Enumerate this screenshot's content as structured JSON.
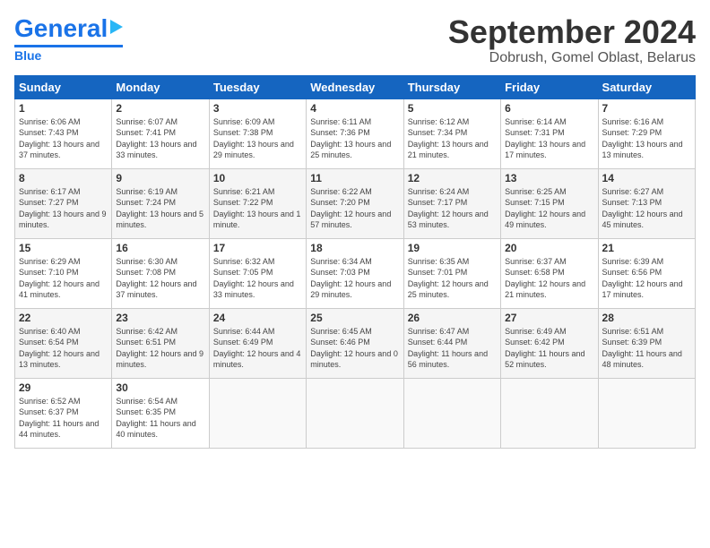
{
  "header": {
    "logo_general": "General",
    "logo_blue": "Blue",
    "month_title": "September 2024",
    "location": "Dobrush, Gomel Oblast, Belarus"
  },
  "weekdays": [
    "Sunday",
    "Monday",
    "Tuesday",
    "Wednesday",
    "Thursday",
    "Friday",
    "Saturday"
  ],
  "weeks": [
    [
      {
        "day": "1",
        "sunrise": "Sunrise: 6:06 AM",
        "sunset": "Sunset: 7:43 PM",
        "daylight": "Daylight: 13 hours and 37 minutes."
      },
      {
        "day": "2",
        "sunrise": "Sunrise: 6:07 AM",
        "sunset": "Sunset: 7:41 PM",
        "daylight": "Daylight: 13 hours and 33 minutes."
      },
      {
        "day": "3",
        "sunrise": "Sunrise: 6:09 AM",
        "sunset": "Sunset: 7:38 PM",
        "daylight": "Daylight: 13 hours and 29 minutes."
      },
      {
        "day": "4",
        "sunrise": "Sunrise: 6:11 AM",
        "sunset": "Sunset: 7:36 PM",
        "daylight": "Daylight: 13 hours and 25 minutes."
      },
      {
        "day": "5",
        "sunrise": "Sunrise: 6:12 AM",
        "sunset": "Sunset: 7:34 PM",
        "daylight": "Daylight: 13 hours and 21 minutes."
      },
      {
        "day": "6",
        "sunrise": "Sunrise: 6:14 AM",
        "sunset": "Sunset: 7:31 PM",
        "daylight": "Daylight: 13 hours and 17 minutes."
      },
      {
        "day": "7",
        "sunrise": "Sunrise: 6:16 AM",
        "sunset": "Sunset: 7:29 PM",
        "daylight": "Daylight: 13 hours and 13 minutes."
      }
    ],
    [
      {
        "day": "8",
        "sunrise": "Sunrise: 6:17 AM",
        "sunset": "Sunset: 7:27 PM",
        "daylight": "Daylight: 13 hours and 9 minutes."
      },
      {
        "day": "9",
        "sunrise": "Sunrise: 6:19 AM",
        "sunset": "Sunset: 7:24 PM",
        "daylight": "Daylight: 13 hours and 5 minutes."
      },
      {
        "day": "10",
        "sunrise": "Sunrise: 6:21 AM",
        "sunset": "Sunset: 7:22 PM",
        "daylight": "Daylight: 13 hours and 1 minute."
      },
      {
        "day": "11",
        "sunrise": "Sunrise: 6:22 AM",
        "sunset": "Sunset: 7:20 PM",
        "daylight": "Daylight: 12 hours and 57 minutes."
      },
      {
        "day": "12",
        "sunrise": "Sunrise: 6:24 AM",
        "sunset": "Sunset: 7:17 PM",
        "daylight": "Daylight: 12 hours and 53 minutes."
      },
      {
        "day": "13",
        "sunrise": "Sunrise: 6:25 AM",
        "sunset": "Sunset: 7:15 PM",
        "daylight": "Daylight: 12 hours and 49 minutes."
      },
      {
        "day": "14",
        "sunrise": "Sunrise: 6:27 AM",
        "sunset": "Sunset: 7:13 PM",
        "daylight": "Daylight: 12 hours and 45 minutes."
      }
    ],
    [
      {
        "day": "15",
        "sunrise": "Sunrise: 6:29 AM",
        "sunset": "Sunset: 7:10 PM",
        "daylight": "Daylight: 12 hours and 41 minutes."
      },
      {
        "day": "16",
        "sunrise": "Sunrise: 6:30 AM",
        "sunset": "Sunset: 7:08 PM",
        "daylight": "Daylight: 12 hours and 37 minutes."
      },
      {
        "day": "17",
        "sunrise": "Sunrise: 6:32 AM",
        "sunset": "Sunset: 7:05 PM",
        "daylight": "Daylight: 12 hours and 33 minutes."
      },
      {
        "day": "18",
        "sunrise": "Sunrise: 6:34 AM",
        "sunset": "Sunset: 7:03 PM",
        "daylight": "Daylight: 12 hours and 29 minutes."
      },
      {
        "day": "19",
        "sunrise": "Sunrise: 6:35 AM",
        "sunset": "Sunset: 7:01 PM",
        "daylight": "Daylight: 12 hours and 25 minutes."
      },
      {
        "day": "20",
        "sunrise": "Sunrise: 6:37 AM",
        "sunset": "Sunset: 6:58 PM",
        "daylight": "Daylight: 12 hours and 21 minutes."
      },
      {
        "day": "21",
        "sunrise": "Sunrise: 6:39 AM",
        "sunset": "Sunset: 6:56 PM",
        "daylight": "Daylight: 12 hours and 17 minutes."
      }
    ],
    [
      {
        "day": "22",
        "sunrise": "Sunrise: 6:40 AM",
        "sunset": "Sunset: 6:54 PM",
        "daylight": "Daylight: 12 hours and 13 minutes."
      },
      {
        "day": "23",
        "sunrise": "Sunrise: 6:42 AM",
        "sunset": "Sunset: 6:51 PM",
        "daylight": "Daylight: 12 hours and 9 minutes."
      },
      {
        "day": "24",
        "sunrise": "Sunrise: 6:44 AM",
        "sunset": "Sunset: 6:49 PM",
        "daylight": "Daylight: 12 hours and 4 minutes."
      },
      {
        "day": "25",
        "sunrise": "Sunrise: 6:45 AM",
        "sunset": "Sunset: 6:46 PM",
        "daylight": "Daylight: 12 hours and 0 minutes."
      },
      {
        "day": "26",
        "sunrise": "Sunrise: 6:47 AM",
        "sunset": "Sunset: 6:44 PM",
        "daylight": "Daylight: 11 hours and 56 minutes."
      },
      {
        "day": "27",
        "sunrise": "Sunrise: 6:49 AM",
        "sunset": "Sunset: 6:42 PM",
        "daylight": "Daylight: 11 hours and 52 minutes."
      },
      {
        "day": "28",
        "sunrise": "Sunrise: 6:51 AM",
        "sunset": "Sunset: 6:39 PM",
        "daylight": "Daylight: 11 hours and 48 minutes."
      }
    ],
    [
      {
        "day": "29",
        "sunrise": "Sunrise: 6:52 AM",
        "sunset": "Sunset: 6:37 PM",
        "daylight": "Daylight: 11 hours and 44 minutes."
      },
      {
        "day": "30",
        "sunrise": "Sunrise: 6:54 AM",
        "sunset": "Sunset: 6:35 PM",
        "daylight": "Daylight: 11 hours and 40 minutes."
      },
      null,
      null,
      null,
      null,
      null
    ]
  ]
}
